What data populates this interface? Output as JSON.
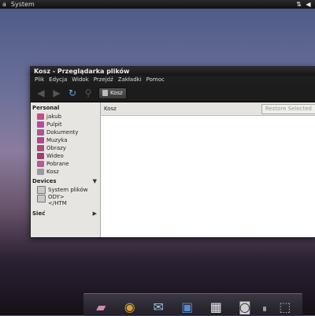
{
  "top_panel": {
    "menu_left_char": "a",
    "system_label": "System"
  },
  "window": {
    "title": "Kosz - Przeglądarka plików",
    "menu": [
      "Plik",
      "Edycja",
      "Widok",
      "Przejdź",
      "Zakładki",
      "Pomoc"
    ],
    "location": "Kosz"
  },
  "sidebar": {
    "personal_title": "Personal",
    "personal_items": [
      {
        "label": "jakub",
        "icon": "home-folder-icon",
        "color": "#c34f88"
      },
      {
        "label": "Pulpit",
        "icon": "desktop-folder-icon",
        "color": "#b34da0"
      },
      {
        "label": "Dokumenty",
        "icon": "documents-folder-icon",
        "color": "#a35a90"
      },
      {
        "label": "Muzyka",
        "icon": "music-folder-icon",
        "color": "#b0488a"
      },
      {
        "label": "Obrazy",
        "icon": "pictures-folder-icon",
        "color": "#a54e7c"
      },
      {
        "label": "Wideo",
        "icon": "video-folder-icon",
        "color": "#9a3e70"
      },
      {
        "label": "Pobrane",
        "icon": "downloads-folder-icon",
        "color": "#b25d96"
      },
      {
        "label": "Kosz",
        "icon": "trash-icon",
        "color": "#9a9a9a"
      }
    ],
    "devices_title": "Devices",
    "device_items": [
      {
        "label": "System plików",
        "icon": "drive-icon"
      },
      {
        "label": "ODY>\n</HTM",
        "icon": "drive-icon"
      }
    ],
    "network_title": "Sieć"
  },
  "main": {
    "header_title": "Kosz",
    "restore_button": "Restore Selected"
  },
  "dock": {
    "apps": [
      "folder-app-icon",
      "browser-app-icon",
      "chat-app-icon",
      "photos-app-icon",
      "video-app-icon",
      "speaker-app-icon",
      "trash-app-icon"
    ]
  }
}
